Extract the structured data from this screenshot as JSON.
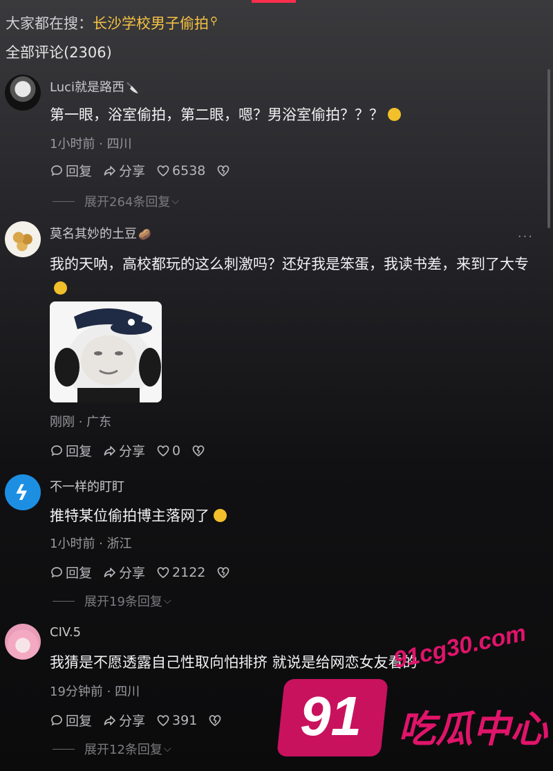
{
  "header": {
    "search_prefix": "大家都在搜：",
    "search_keyword": "长沙学校男子偷拍",
    "all_comments": "全部评论(2306)"
  },
  "actions": {
    "reply": "回复",
    "share": "分享"
  },
  "comments": [
    {
      "username": "Luci就是路西",
      "text": "第一眼，浴室偷拍，第二眼，嗯？男浴室偷拍？？？",
      "meta": "1小时前 · 四川",
      "likes": "6538",
      "expand": "展开264条回复"
    },
    {
      "username": "莫名其妙的土豆",
      "text": "我的天呐，高校都玩的这么刺激吗？还好我是笨蛋，我读书差，来到了大专",
      "meta": "刚刚 · 广东",
      "likes": "0",
      "more": "···"
    },
    {
      "username": "不一样的盯盯",
      "text": "推特某位偷拍博主落网了",
      "meta": "1小时前 · 浙江",
      "likes": "2122",
      "expand": "展开19条回复"
    },
    {
      "username": "CIV.5",
      "text": "我猜是不愿透露自己性取向怕排挤 就说是给网恋女友看的",
      "meta": "19分钟前 · 四川",
      "likes": "391",
      "expand": "展开12条回复"
    }
  ],
  "watermark": {
    "site": "91cg30.com",
    "number": "91",
    "name": "吃瓜中心"
  },
  "colors": {
    "keyword": "#f5c242",
    "accent": "#ff2e4d",
    "watermark": "#e0146a"
  }
}
